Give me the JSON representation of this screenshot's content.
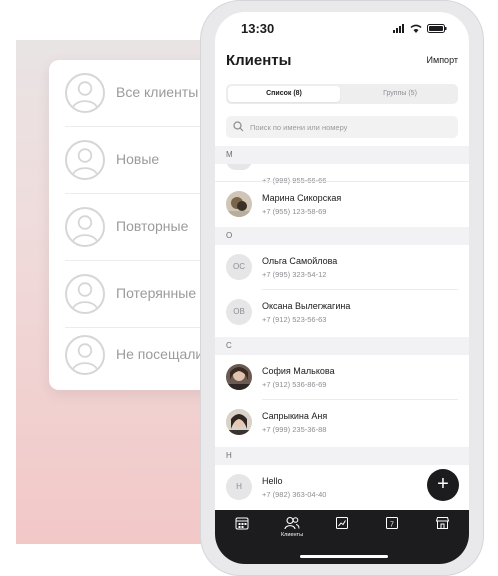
{
  "segments": [
    {
      "label": "Все клиенты"
    },
    {
      "label": "Новые"
    },
    {
      "label": "Повторные"
    },
    {
      "label": "Потерянные"
    },
    {
      "label": "Не посещали"
    }
  ],
  "status_bar": {
    "time": "13:30",
    "icons": [
      "signal-icon",
      "wifi-icon",
      "battery-icon"
    ]
  },
  "header": {
    "title": "Клиенты",
    "import_label": "Импорт"
  },
  "tabs": [
    {
      "label": "Список (8)",
      "selected": true
    },
    {
      "label": "Группы (5)",
      "selected": false
    }
  ],
  "search": {
    "placeholder": "Поиск по имени или номеру",
    "value": ""
  },
  "contacts": {
    "partial_phone": "+7 (998) 955-66-66",
    "m_label": "М",
    "m": [
      {
        "name": "Марина Сикорская",
        "phone": "+7 (955) 123-58-69",
        "avatar": "photo"
      }
    ],
    "o_label": "О",
    "o": [
      {
        "name": "Ольга Самойлова",
        "phone": "+7 (995) 323-54-12",
        "initials": "ОС"
      },
      {
        "name": "Оксана Вылегжагина",
        "phone": "+7 (912) 523-56-63",
        "initials": "ОВ"
      }
    ],
    "s_label": "С",
    "s": [
      {
        "name": "София Малькова",
        "phone": "+7 (912) 536-86-69",
        "avatar": "photo"
      },
      {
        "name": "Сапрыкина Аня",
        "phone": "+7 (999) 235-36-88",
        "avatar": "photo"
      }
    ],
    "h_label": "Н",
    "h": [
      {
        "name": "Hello",
        "phone": "+7 (982) 363-04-40",
        "initials": "H"
      }
    ]
  },
  "fab": {
    "icon": "plus-icon",
    "label": "+"
  },
  "tabbar": {
    "items": [
      {
        "icon": "calendar-icon",
        "label": ""
      },
      {
        "icon": "clients-icon",
        "label": "Клиенты",
        "active": true
      },
      {
        "icon": "chart-icon",
        "label": ""
      },
      {
        "icon": "calendar-day-icon",
        "label": ""
      },
      {
        "icon": "store-icon",
        "label": ""
      }
    ]
  },
  "colors": {
    "accent": "#1c1c1e",
    "backdrop_top": "#e9e4e4",
    "backdrop_bottom": "#f2c8c7"
  }
}
